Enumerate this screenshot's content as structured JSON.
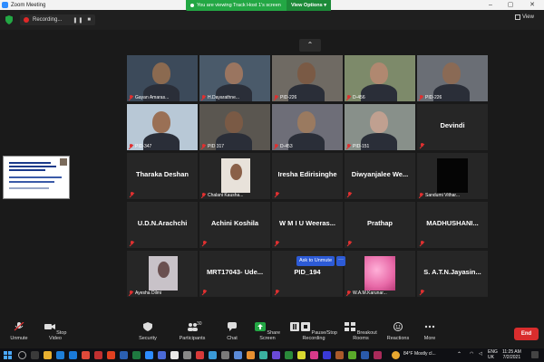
{
  "window": {
    "title": "Zoom Meeting"
  },
  "recording": {
    "label": "Recording..."
  },
  "banner": {
    "text": "You are viewing Track Host 1's screen",
    "view_options": "View Options"
  },
  "view_label": "View",
  "ask_to_unmute": "Ask to Unmute",
  "more_dots": "···",
  "tiles": [
    {
      "name": "",
      "caption": "Gayan Amaras...",
      "video": true,
      "bg": "#3c4a5a",
      "skin": "#8b6a50"
    },
    {
      "name": "",
      "caption": "H.Dayarathne...",
      "video": true,
      "bg": "#4a5a6a",
      "skin": "#9a7560"
    },
    {
      "name": "",
      "caption": "PID-226",
      "video": true,
      "bg": "#6f6a63",
      "skin": "#7a5a45"
    },
    {
      "name": "",
      "caption": "D-456",
      "video": true,
      "bg": "#7d8a6a",
      "skin": "#b08870"
    },
    {
      "name": "",
      "caption": "PID-226",
      "video": true,
      "bg": "#6a6e75",
      "skin": "#8a6a55"
    },
    {
      "name": "",
      "caption": "PID-347",
      "video": true,
      "bg": "#b8c8d6",
      "skin": "#9a7055"
    },
    {
      "name": "",
      "caption": "PID 317",
      "video": true,
      "bg": "#5a5650",
      "skin": "#7a5a45"
    },
    {
      "name": "",
      "caption": "D-453",
      "video": true,
      "bg": "#6e6e78",
      "skin": "#9a7a60"
    },
    {
      "name": "",
      "caption": "PID-151",
      "video": true,
      "bg": "#88908a",
      "skin": "#c0a090"
    },
    {
      "name": "Devindi",
      "caption": "",
      "video": false
    },
    {
      "name": "Tharaka Deshan",
      "caption": "",
      "video": false
    },
    {
      "name": "",
      "caption": "Chalani Kausha...",
      "video": "photo",
      "bg": "#e8e2da",
      "skin": "#8a6048"
    },
    {
      "name": "Iresha Edirisinghe",
      "caption": "",
      "video": false
    },
    {
      "name": "Diwyanjalee  We...",
      "caption": "",
      "video": false
    },
    {
      "name": "",
      "caption": "Sandumi Vithar...",
      "video": "dark",
      "bg": "#050505"
    },
    {
      "name": "U.D.N.Arachchi",
      "caption": "",
      "video": false
    },
    {
      "name": "Achini Koshila",
      "caption": "",
      "video": false
    },
    {
      "name": "W M I U Weeras...",
      "caption": "",
      "video": false
    },
    {
      "name": "Prathap",
      "caption": "",
      "video": false
    },
    {
      "name": "MADHUSHANI...",
      "caption": "",
      "video": false
    },
    {
      "name": "",
      "caption": "Ayesha Dilmi",
      "video": "photo",
      "bg": "#c8c2c8",
      "skin": "#6a5050"
    },
    {
      "name": "MRT17043- Ude...",
      "caption": "",
      "video": false
    },
    {
      "name": "PID_194",
      "caption": "",
      "video": false
    },
    {
      "name": "",
      "caption": "W.A.M.Karunar...",
      "video": "pink",
      "bg": "#e86aa8"
    },
    {
      "name": "S. A.T.N.Jayasin...",
      "caption": "",
      "video": false
    }
  ],
  "toolbar": {
    "unmute": "Unmute",
    "stop_video": "Stop Video",
    "security": "Security",
    "participants": "Participants",
    "participants_count": "30",
    "chat": "Chat",
    "share_screen": "Share Screen",
    "pause_recording": "Pause/Stop Recording",
    "breakout_rooms": "Breakout Rooms",
    "reactions": "Reactions",
    "more": "More",
    "end": "End"
  },
  "taskbar": {
    "weather": "84°F  Mostly cl...",
    "language": "ENG",
    "region": "UK",
    "time": "11:25 AM",
    "date": "7/2/2021"
  },
  "colors": {
    "share_green": "#23a744",
    "end_red": "#d92d2d",
    "unmute_blue": "#2d5bd6",
    "muted_red": "#e03030"
  }
}
